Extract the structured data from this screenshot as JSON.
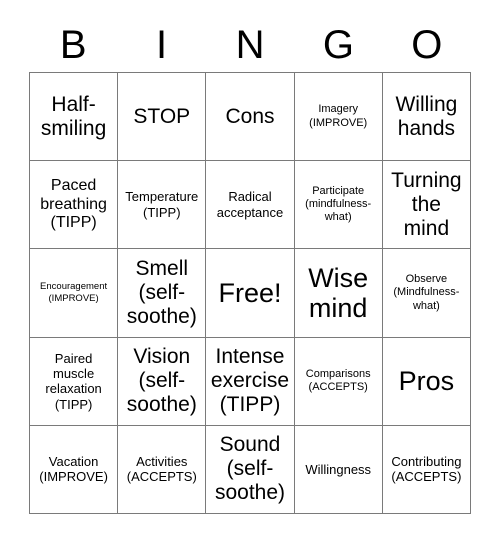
{
  "card": {
    "title": "BINGO",
    "header_letters": [
      "B",
      "I",
      "N",
      "G",
      "O"
    ],
    "rows": 5,
    "columns": 5,
    "border_color": "#7a7a7a",
    "background_color": "#ffffff",
    "text_color": "#000000",
    "free_space_label": "Free!",
    "free_space_position": "row-3-column-3"
  },
  "cells": [
    {
      "text": "Half-\nsmiling",
      "size": "lg"
    },
    {
      "text": "STOP",
      "size": "lg"
    },
    {
      "text": "Cons",
      "size": "lg"
    },
    {
      "text": "Imagery\n(IMPROVE)",
      "size": "xs"
    },
    {
      "text": "Willing\nhands",
      "size": "lg"
    },
    {
      "text": "Paced\nbreathing\n(TIPP)",
      "size": "md"
    },
    {
      "text": "Temperature\n(TIPP)",
      "size": "sm"
    },
    {
      "text": "Radical\nacceptance",
      "size": "sm"
    },
    {
      "text": "Participate\n(mindfulness-\nwhat)",
      "size": "xs"
    },
    {
      "text": "Turning\nthe\nmind",
      "size": "lg"
    },
    {
      "text": "Encouragement\n(IMPROVE)",
      "size": "xxs"
    },
    {
      "text": "Smell\n(self-\nsoothe)",
      "size": "lg"
    },
    {
      "text": "Free!",
      "size": "xl"
    },
    {
      "text": "Wise\nmind",
      "size": "xl"
    },
    {
      "text": "Observe\n(Mindfulness-\nwhat)",
      "size": "xs"
    },
    {
      "text": "Paired\nmuscle\nrelaxation\n(TIPP)",
      "size": "sm"
    },
    {
      "text": "Vision\n(self-\nsoothe)",
      "size": "lg"
    },
    {
      "text": "Intense\nexercise\n(TIPP)",
      "size": "lg"
    },
    {
      "text": "Comparisons\n(ACCEPTS)",
      "size": "xs"
    },
    {
      "text": "Pros",
      "size": "xl"
    },
    {
      "text": "Vacation\n(IMPROVE)",
      "size": "sm"
    },
    {
      "text": "Activities\n(ACCEPTS)",
      "size": "sm"
    },
    {
      "text": "Sound\n(self-\nsoothe)",
      "size": "lg"
    },
    {
      "text": "Willingness",
      "size": "sm"
    },
    {
      "text": "Contributing\n(ACCEPTS)",
      "size": "sm"
    }
  ]
}
